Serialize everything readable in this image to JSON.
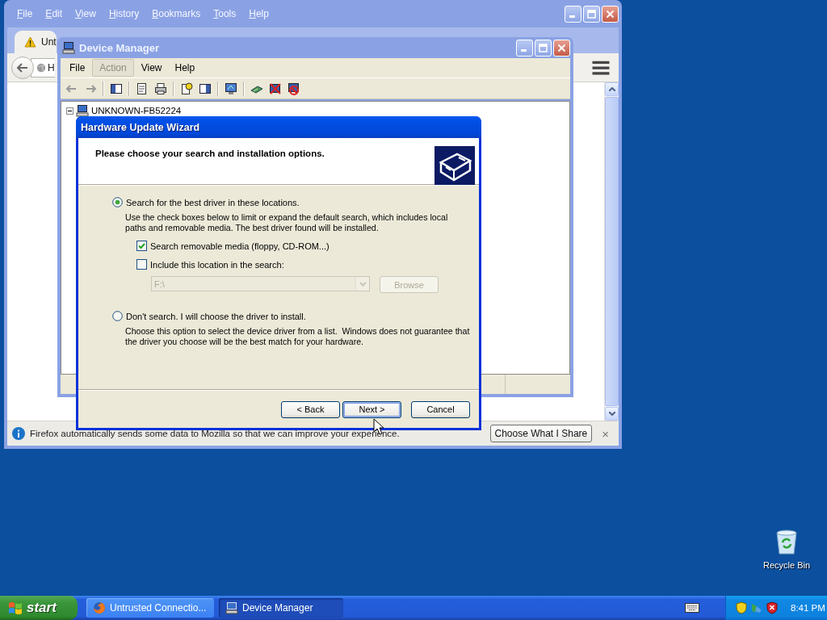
{
  "firefox": {
    "menu": [
      "File",
      "Edit",
      "View",
      "History",
      "Bookmarks",
      "Tools",
      "Help"
    ],
    "tab": {
      "title": "Unt"
    },
    "address": "H",
    "notification": {
      "text": "Firefox automatically sends some data to Mozilla so that we can improve your experience.",
      "button": "Choose What I Share",
      "close": "×"
    }
  },
  "device_manager": {
    "title": "Device Manager",
    "menu": [
      {
        "label": "File",
        "disabled": false
      },
      {
        "label": "Action",
        "disabled": true
      },
      {
        "label": "View",
        "disabled": false
      },
      {
        "label": "Help",
        "disabled": false
      }
    ],
    "tree": [
      {
        "label": "UNKNOWN-FB52224",
        "expanded": true
      }
    ]
  },
  "wizard": {
    "title": "Hardware Update Wizard",
    "heading": "Please choose your search and installation options.",
    "options": [
      {
        "label": "Search for the best driver in these locations.",
        "selected": true,
        "description": "Use the check boxes below to limit or expand the default search, which includes local paths and removable media. The best driver found will be installed.",
        "checkboxes": [
          {
            "label": "Search removable media (floppy, CD-ROM...)",
            "checked": true
          },
          {
            "label": "Include this location in the search:",
            "checked": false
          }
        ],
        "location": {
          "value": "F:\\",
          "disabled": true
        },
        "browse": {
          "label": "Browse",
          "disabled": true
        }
      },
      {
        "label": "Don't search. I will choose the driver to install.",
        "selected": false,
        "description": "Choose this option to select the device driver from a list.  Windows does not guarantee that the driver you choose will be the best match for your hardware."
      }
    ],
    "buttons": [
      {
        "label": "< Back",
        "default": false
      },
      {
        "label": "Next >",
        "default": true
      },
      {
        "label": "Cancel",
        "default": false
      }
    ]
  },
  "desktop_icons": [
    {
      "label": "Recycle Bin"
    }
  ],
  "taskbar": {
    "start": "start",
    "tasks": [
      {
        "label": "Untrusted Connectio...",
        "selected": false,
        "kind": "browser"
      },
      {
        "label": "Device Manager",
        "selected": true,
        "kind": "device-manager"
      }
    ],
    "clock": "8:41 PM"
  }
}
